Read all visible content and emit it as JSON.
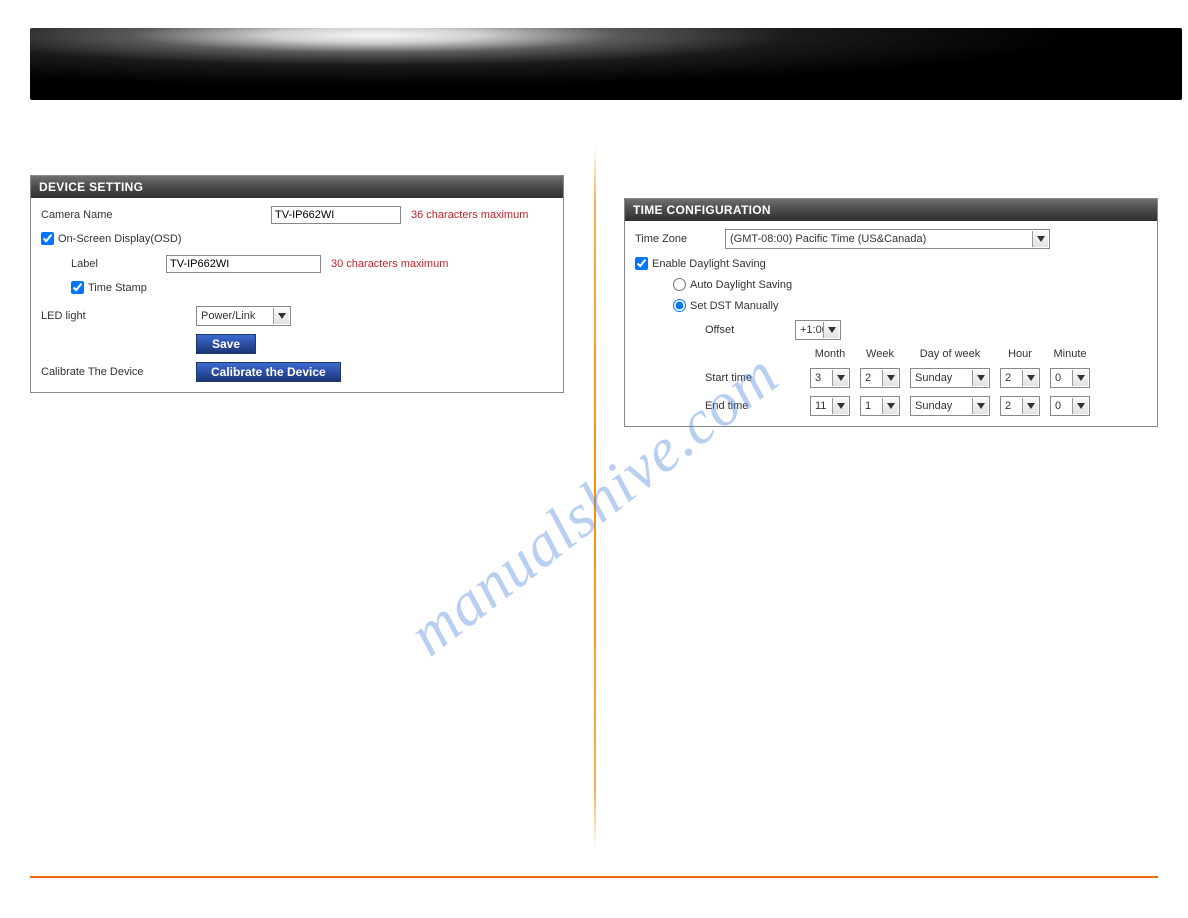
{
  "watermark": "manualshive.com",
  "device_setting": {
    "header": "DEVICE SETTING",
    "camera_name_label": "Camera Name",
    "camera_name_value": "TV-IP662WI",
    "camera_name_hint": "36 characters maximum",
    "osd_label": "On-Screen Display(OSD)",
    "osd_checked": true,
    "label_label": "Label",
    "label_value": "TV-IP662WI",
    "label_hint": "30 characters maximum",
    "timestamp_label": "Time Stamp",
    "timestamp_checked": true,
    "led_label": "LED light",
    "led_value": "Power/Link",
    "save_button": "Save",
    "calibrate_label": "Calibrate The Device",
    "calibrate_button": "Calibrate the Device"
  },
  "time_config": {
    "header": "TIME CONFIGURATION",
    "timezone_label": "Time Zone",
    "timezone_value": "(GMT-08:00) Pacific Time (US&Canada)",
    "enable_dst_label": "Enable Daylight Saving",
    "enable_dst_checked": true,
    "auto_dst_label": "Auto Daylight Saving",
    "auto_dst_selected": false,
    "manual_dst_label": "Set DST Manually",
    "manual_dst_selected": true,
    "offset_label": "Offset",
    "offset_value": "+1:00",
    "col_month": "Month",
    "col_week": "Week",
    "col_dow": "Day of week",
    "col_hour": "Hour",
    "col_minute": "Minute",
    "start_label": "Start time",
    "start": {
      "month": "3",
      "week": "2",
      "dow": "Sunday",
      "hour": "2",
      "minute": "0"
    },
    "end_label": "End time",
    "end": {
      "month": "11",
      "week": "1",
      "dow": "Sunday",
      "hour": "2",
      "minute": "0"
    }
  }
}
